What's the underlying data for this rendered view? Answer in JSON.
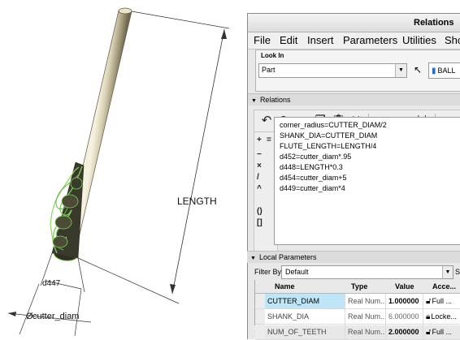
{
  "drawing": {
    "length_label": "LENGTH",
    "d447_label": "d447",
    "diam_label": "cutter_diam",
    "diam_symbol": "Ø"
  },
  "window": {
    "title": "Relations",
    "menu": [
      "File",
      "Edit",
      "Insert",
      "Parameters",
      "Utilities",
      "Sho"
    ],
    "lookin": {
      "legend": "Look In",
      "type_value": "Part",
      "model_label": "BALL"
    },
    "relations": {
      "header": "Relations",
      "lines": [
        "corner_radius=CUTTER_DIAM/2",
        "SHANK_DIA=CUTTER_DIAM",
        "FLUTE_LENGTH=LENGTH/4",
        "d452=cutter_diam*.95",
        "d448=LENGTH*0.3",
        "d454=cutter_diam+5",
        "d449=cutter_diam*4"
      ]
    },
    "local_params": {
      "header": "Local Parameters",
      "filter_label": "Filter By",
      "filter_value": "Default",
      "s_label": "S",
      "columns": [
        "Name",
        "Type",
        "Value",
        "Acce..."
      ],
      "rows": [
        {
          "name": "CUTTER_DIAM",
          "type": "Real Num...",
          "value": "1.000000",
          "access": "Full",
          "more": "..."
        },
        {
          "name": "SHANK_DIA",
          "type": "Real Num...",
          "value": "6.000000",
          "access": "Locke...",
          "more": ""
        },
        {
          "name": "NUM_OF_TEETH",
          "type": "Real Num...",
          "value": "2.000000",
          "access": "Full",
          "more": "..."
        }
      ]
    }
  },
  "colors": {
    "selected_cell": "#bfe6f7",
    "tool_highlight": "#7ed05a"
  }
}
